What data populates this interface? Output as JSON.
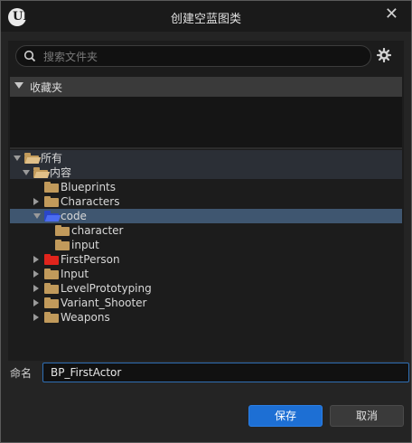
{
  "window": {
    "title": "创建空蓝图类",
    "logo": "UE"
  },
  "search": {
    "placeholder": "搜索文件夹",
    "value": ""
  },
  "favorites": {
    "label": "收藏夹"
  },
  "tree": [
    {
      "label": "所有",
      "level": 0,
      "expanded": true,
      "folder": "tan"
    },
    {
      "label": "内容",
      "level": 1,
      "expanded": true,
      "folder": "tan"
    },
    {
      "label": "Blueprints",
      "level": 2,
      "expander": "none",
      "folder": "tan"
    },
    {
      "label": "Characters",
      "level": 2,
      "expander": "right",
      "folder": "tan"
    },
    {
      "label": "code",
      "level": 2,
      "expander": "down",
      "folder": "blue",
      "selected": true
    },
    {
      "label": "character",
      "level": 3,
      "expander": "none",
      "folder": "tan"
    },
    {
      "label": "input",
      "level": 3,
      "expander": "none",
      "folder": "tan"
    },
    {
      "label": "FirstPerson",
      "level": 2,
      "expander": "right",
      "folder": "red"
    },
    {
      "label": "Input",
      "level": 2,
      "expander": "right",
      "folder": "tan"
    },
    {
      "label": "LevelPrototyping",
      "level": 2,
      "expander": "right",
      "folder": "tan"
    },
    {
      "label": "Variant_Shooter",
      "level": 2,
      "expander": "right",
      "folder": "tan"
    },
    {
      "label": "Weapons",
      "level": 2,
      "expander": "right",
      "folder": "tan"
    }
  ],
  "name": {
    "label": "命名",
    "value": "BP_FirstActor"
  },
  "buttons": {
    "save": "保存",
    "cancel": "取消"
  },
  "colors": {
    "accent": "#1d6fd4",
    "selection": "#3f5670",
    "folder": "#c19a5b",
    "red_folder": "#e0241c",
    "blue_folder": "#2a46c8"
  }
}
